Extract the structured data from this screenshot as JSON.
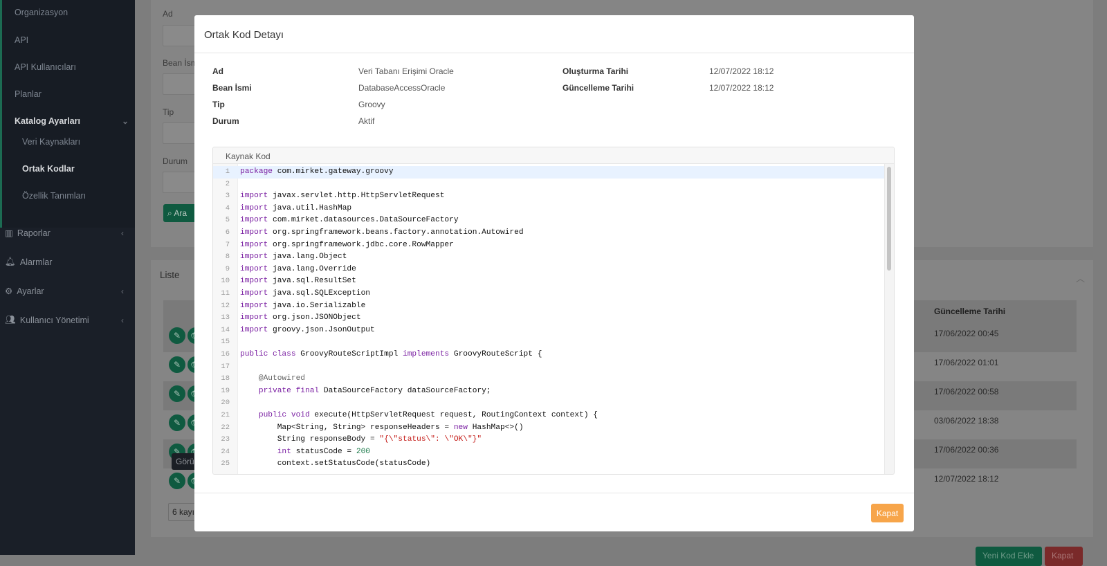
{
  "sidebar": {
    "items": [
      {
        "label": "Organizasyon"
      },
      {
        "label": "API"
      },
      {
        "label": "API Kullanıcıları"
      },
      {
        "label": "Planlar"
      },
      {
        "label": "Katalog Ayarları"
      }
    ],
    "sub_items": [
      {
        "label": "Veri Kaynakları"
      },
      {
        "label": "Ortak Kodlar",
        "active": true
      },
      {
        "label": "Özellik Tanımları"
      }
    ],
    "main_items": [
      {
        "label": "Raporlar",
        "icon": "chart-icon"
      },
      {
        "label": "Alarmlar",
        "icon": "bell-icon"
      },
      {
        "label": "Ayarlar",
        "icon": "gears-icon"
      },
      {
        "label": "Kullanıcı Yönetimi",
        "icon": "users-icon"
      }
    ]
  },
  "search": {
    "labels": [
      "Ad",
      "Bean İsmi",
      "Tip",
      "Durum"
    ],
    "button": "Ara"
  },
  "list": {
    "title": "Liste",
    "column": "Güncelleme Tarihi",
    "rows": [
      "17/06/2022 00:45",
      "17/06/2022 01:01",
      "17/06/2022 00:58",
      "03/06/2022 18:38",
      "17/06/2022 00:36",
      "12/07/2022 18:12"
    ],
    "tooltip": "Görü",
    "page_size": "6 kayı",
    "new_button": "Yeni Kod Ekle",
    "close_button": "Kapat"
  },
  "modal": {
    "title": "Ortak Kod Detayı",
    "fields": [
      {
        "label": "Ad",
        "value": "Veri Tabanı Erişimi Oracle"
      },
      {
        "label": "Bean İsmi",
        "value": "DatabaseAccessOracle"
      },
      {
        "label": "Tip",
        "value": "Groovy"
      },
      {
        "label": "Durum",
        "value": "Aktif"
      }
    ],
    "fields_right": [
      {
        "label": "Oluşturma Tarihi",
        "value": "12/07/2022 18:12"
      },
      {
        "label": "Güncelleme Tarihi",
        "value": "12/07/2022 18:12"
      }
    ],
    "code_title": "Kaynak Kod",
    "code": [
      [
        [
          "kw",
          "package"
        ],
        [
          "",
          "com.mirket.gateway.groovy"
        ]
      ],
      [],
      [
        [
          "kw",
          "import"
        ],
        [
          "",
          "javax.servlet.http.HttpServletRequest"
        ]
      ],
      [
        [
          "kw",
          "import"
        ],
        [
          "",
          "java.util.HashMap"
        ]
      ],
      [
        [
          "kw",
          "import"
        ],
        [
          "",
          "com.mirket.datasources.DataSourceFactory"
        ]
      ],
      [
        [
          "kw",
          "import"
        ],
        [
          "",
          "org.springframework.beans.factory.annotation.Autowired"
        ]
      ],
      [
        [
          "kw",
          "import"
        ],
        [
          "",
          "org.springframework.jdbc.core.RowMapper"
        ]
      ],
      [
        [
          "kw",
          "import"
        ],
        [
          "",
          "java.lang.Object"
        ]
      ],
      [
        [
          "kw",
          "import"
        ],
        [
          "",
          "java.lang.Override"
        ]
      ],
      [
        [
          "kw",
          "import"
        ],
        [
          "",
          "java.sql.ResultSet"
        ]
      ],
      [
        [
          "kw",
          "import"
        ],
        [
          "",
          "java.sql.SQLException"
        ]
      ],
      [
        [
          "kw",
          "import"
        ],
        [
          "",
          "java.io.Serializable"
        ]
      ],
      [
        [
          "kw",
          "import"
        ],
        [
          "",
          "org.json.JSONObject"
        ]
      ],
      [
        [
          "kw",
          "import"
        ],
        [
          "",
          "groovy.json.JsonOutput"
        ]
      ],
      [],
      [
        [
          "kw",
          "public class"
        ],
        [
          "",
          "GroovyRouteScriptImpl"
        ],
        [
          "kw",
          "implements"
        ],
        [
          "",
          "GroovyRouteScript {"
        ]
      ],
      [],
      [
        [
          "ann",
          "    @Autowired"
        ]
      ],
      [
        [
          "kw",
          "    private final"
        ],
        [
          "",
          "DataSourceFactory dataSourceFactory;"
        ]
      ],
      [],
      [
        [
          "kw",
          "    public void"
        ],
        [
          "",
          "execute(HttpServletRequest request, RoutingContext context) {"
        ]
      ],
      [
        [
          "",
          "        Map<String, String> responseHeaders ="
        ],
        [
          "kw",
          "new"
        ],
        [
          "",
          "HashMap<>()"
        ]
      ],
      [
        [
          "",
          "        String responseBody ="
        ],
        [
          "str",
          "\"{\\\"status\\\": \\\"OK\\\"}\""
        ]
      ],
      [
        [
          "kw",
          "        int"
        ],
        [
          "",
          "statusCode ="
        ],
        [
          "num",
          "200"
        ]
      ],
      [
        [
          "",
          "        context.setStatusCode(statusCode)"
        ]
      ]
    ],
    "close_button": "Kapat",
    "colors": {
      "accent": "#f7a54a",
      "primary": "#1a7a58",
      "keyword": "#7a1fa2",
      "string": "#c41a16"
    }
  }
}
